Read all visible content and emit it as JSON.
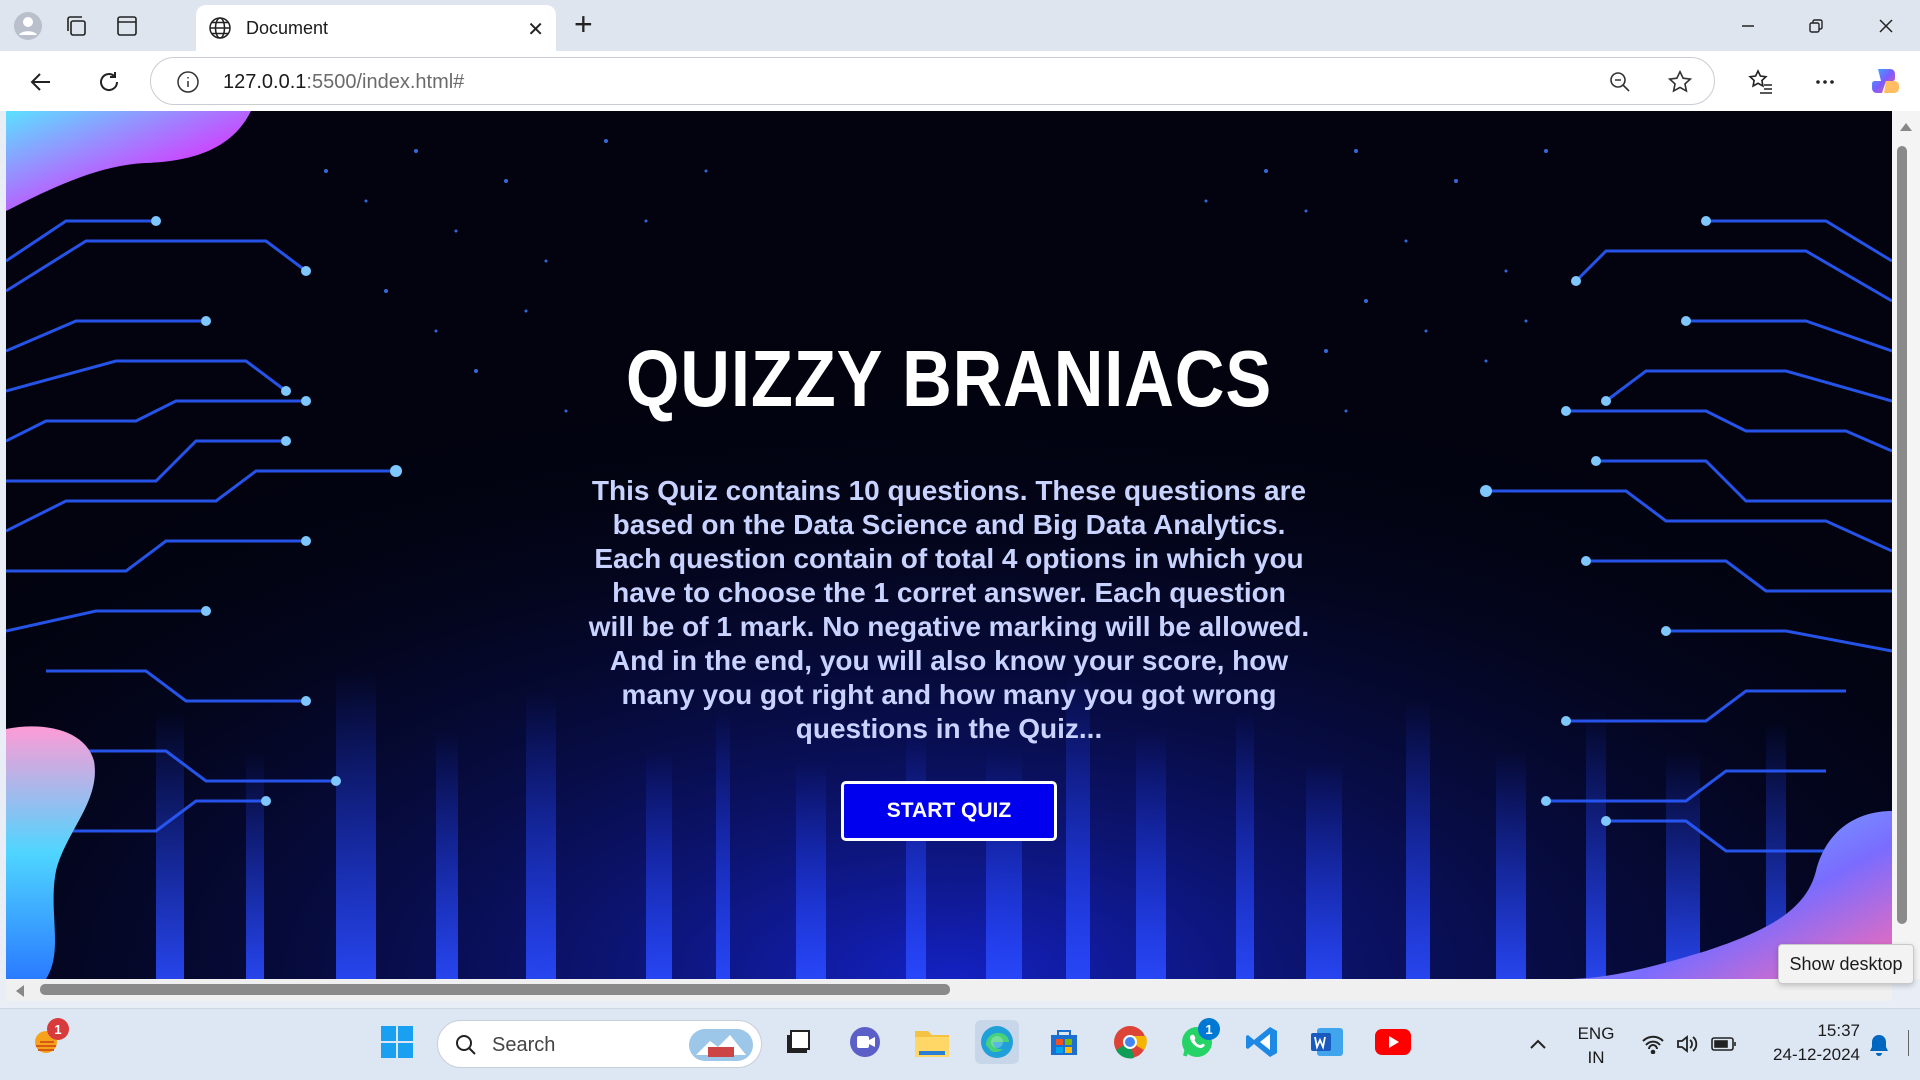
{
  "browser": {
    "tab_title": "Document",
    "url_host": "127.0.0.1",
    "url_rest": ":5500/index.html#"
  },
  "page": {
    "title": "QUIZZY BRANIACS",
    "description": "This Quiz contains 10 questions. These questions are based on the Data Science and Big Data Analytics. Each question contain of total 4 options in which you have to choose the 1 corret answer. Each question will be of 1 mark. No negative marking will be allowed. And in the end, you will also know your score, how many you got right and how many you got wrong questions in the Quiz...",
    "start_button": "START QUIZ"
  },
  "tooltip": "Show desktop",
  "taskbar": {
    "search_label": "Search",
    "weather_badge": "1",
    "whatsapp_badge": "1",
    "lang_top": "ENG",
    "lang_bottom": "IN",
    "time": "15:37",
    "date": "24-12-2024"
  },
  "colors": {
    "accent_button": "#0000ee",
    "page_background": "#02030f",
    "circuit_blue": "#1e5bff"
  },
  "icons": [
    "profile-icon",
    "workspaces-icon",
    "tab-actions-icon",
    "globe-icon",
    "close-icon",
    "new-tab-icon",
    "minimize-icon",
    "restore-icon",
    "window-close-icon",
    "back-icon",
    "refresh-icon",
    "info-icon",
    "zoom-out-icon",
    "favorite-star-icon",
    "favorites-icon",
    "more-icon",
    "copilot-icon",
    "windows-start-icon",
    "search-icon",
    "task-view-icon",
    "teams-icon",
    "file-explorer-icon",
    "edge-icon",
    "store-icon",
    "chrome-icon",
    "whatsapp-icon",
    "vscode-icon",
    "word-icon",
    "youtube-icon",
    "chevron-up-icon",
    "wifi-icon",
    "volume-icon",
    "battery-icon",
    "bell-icon"
  ]
}
